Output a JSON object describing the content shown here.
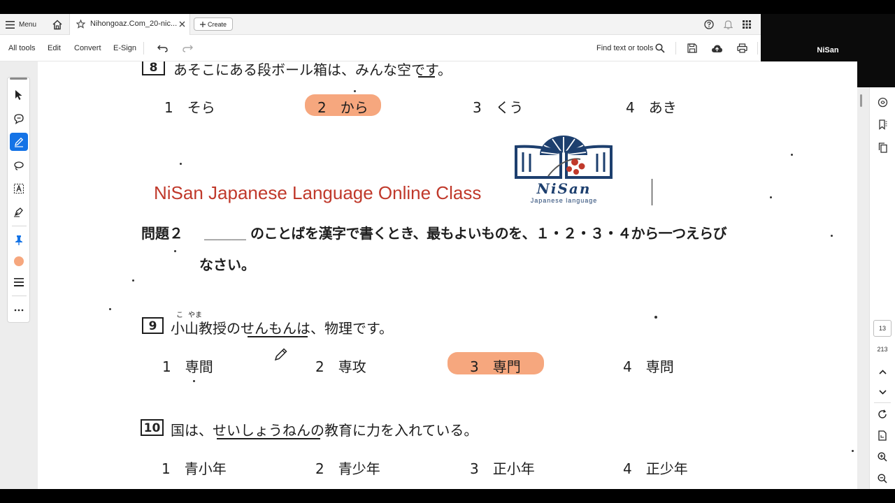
{
  "topbar": {
    "menu_label": "Menu",
    "tab_title": "Nihongoaz.Com_20-nic...",
    "create_label": "Create"
  },
  "toolbar": {
    "all_tools": "All tools",
    "edit": "Edit",
    "convert": "Convert",
    "esign": "E-Sign",
    "find_label": "Find text or tools"
  },
  "video": {
    "participant_name": "NiSan"
  },
  "document": {
    "q8": {
      "number": "8",
      "sentence": "あそこにある段ボール箱は、みんな空です。",
      "choices": [
        {
          "num": "1",
          "text": "そら"
        },
        {
          "num": "2",
          "text": "から"
        },
        {
          "num": "3",
          "text": "くう"
        },
        {
          "num": "4",
          "text": "あき"
        }
      ],
      "selected": 2
    },
    "banner": {
      "title": "NiSan Japanese Language Online Class",
      "logo_name": "NiSan",
      "logo_subtitle": "Japanese language"
    },
    "mondai": {
      "label": "問題２",
      "blank": "＿＿＿",
      "instruction": "のことばを漢字で書くとき、最もよいものを、１・２・３・４から一つえらび",
      "instruction_cont": "なさい。"
    },
    "q9": {
      "number": "9",
      "furigana_ko": "こ",
      "furigana_yama": "やま",
      "sentence_pre": "小山教授の",
      "target": "せんもん",
      "sentence_post": "は、物理です。",
      "choices": [
        {
          "num": "1",
          "text": "専間"
        },
        {
          "num": "2",
          "text": "専攻"
        },
        {
          "num": "3",
          "text": "専門"
        },
        {
          "num": "4",
          "text": "専問"
        }
      ],
      "selected": 3
    },
    "q10": {
      "number": "10",
      "sentence_pre": "国は、",
      "target": "せいしょうねん",
      "sentence_post": "の教育に力を入れている。",
      "choices": [
        {
          "num": "1",
          "text": "青小年"
        },
        {
          "num": "2",
          "text": "青少年"
        },
        {
          "num": "3",
          "text": "正小年"
        },
        {
          "num": "4",
          "text": "正少年"
        }
      ]
    }
  },
  "right_panel": {
    "current_page": "13",
    "total_pages": "213"
  },
  "colors": {
    "highlight": "#f6a77e",
    "banner_red": "#c0392b",
    "logo_navy": "#1d3f6e",
    "accent_blue": "#1473e6"
  }
}
